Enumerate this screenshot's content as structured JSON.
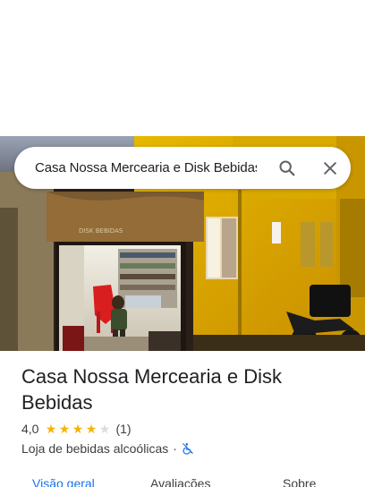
{
  "search": {
    "query": "Casa Nossa Mercearia e Disk Bebidas"
  },
  "place": {
    "name": "Casa Nossa Mercearia e Disk Bebidas",
    "rating": "4,0",
    "rating_stars": 4,
    "review_count": "(1)",
    "category": "Loja de bebidas alcoólicas",
    "separator": "·"
  },
  "photo": {
    "storefront_sign": "DISK BEBIDAS"
  },
  "tabs": [
    {
      "label": "Visão geral",
      "active": true
    },
    {
      "label": "Avaliações",
      "active": false
    },
    {
      "label": "Sobre",
      "active": false
    }
  ],
  "icons": {
    "search": "search-icon",
    "close": "close-icon",
    "star": "star-icon",
    "accessibility": "wheelchair-no-icon"
  },
  "colors": {
    "accent": "#1a73e8",
    "star": "#f4b400",
    "text": "#202124",
    "secondary_text": "#3c4043"
  }
}
